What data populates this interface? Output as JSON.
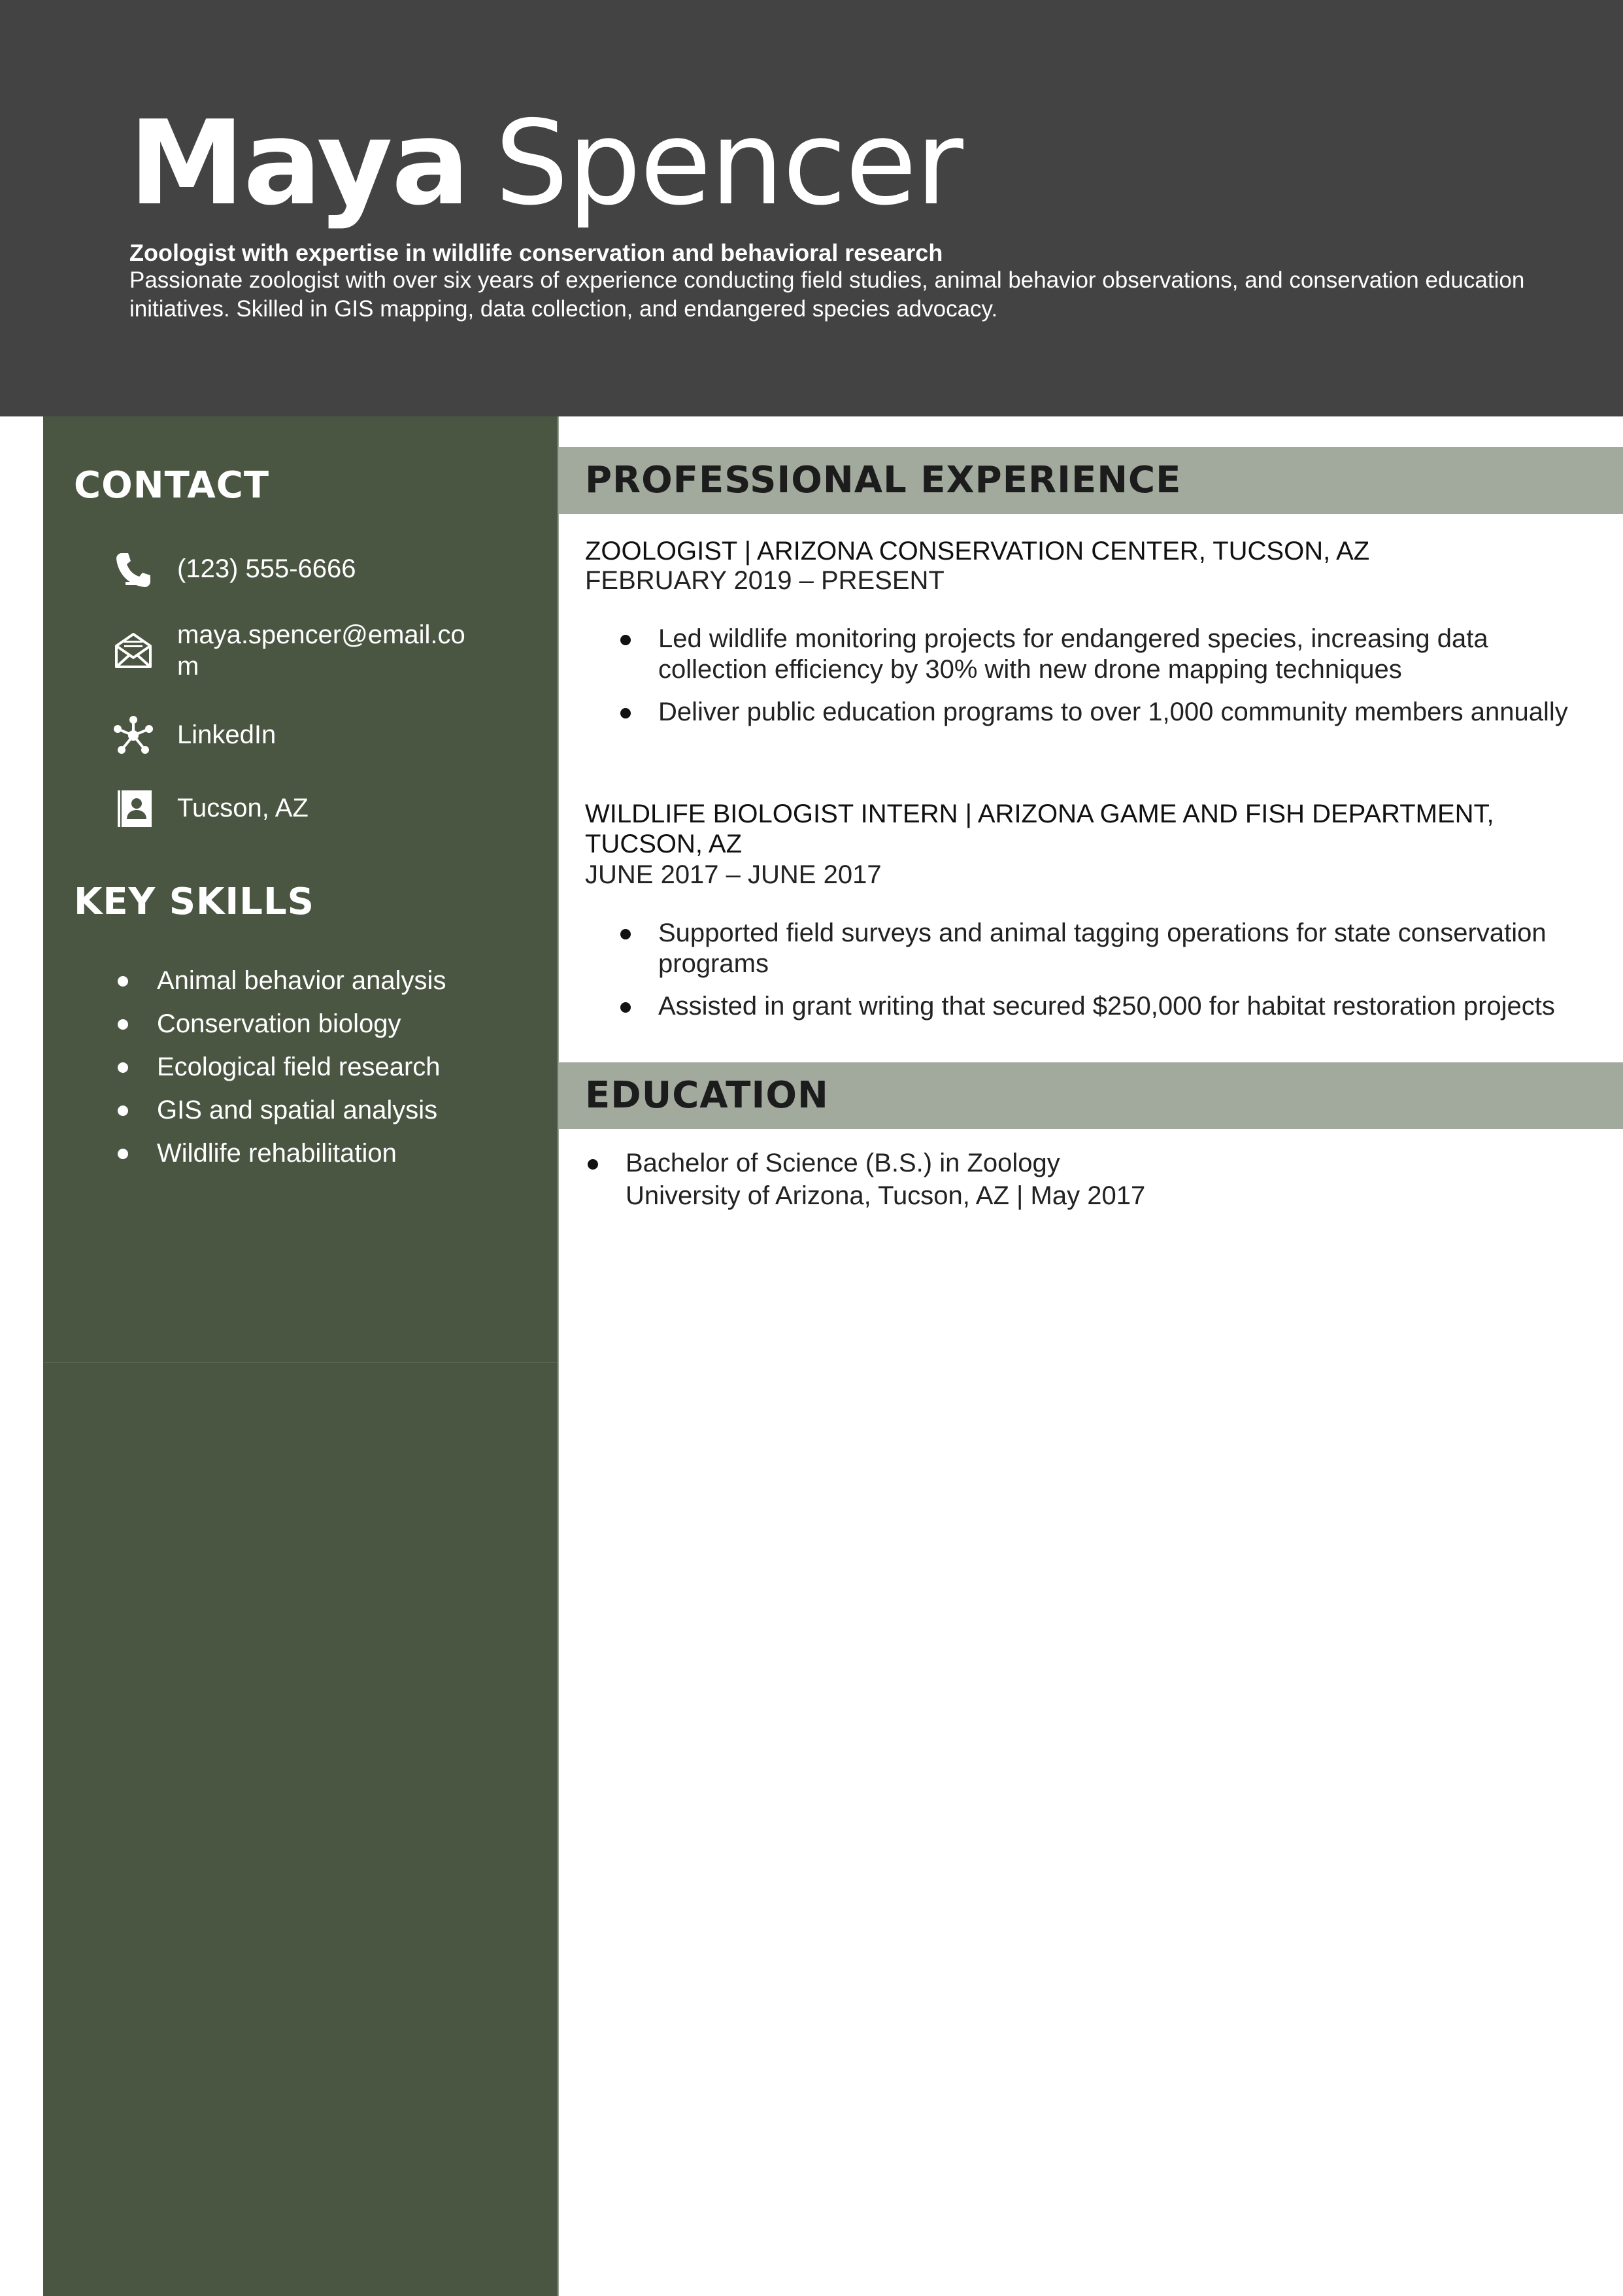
{
  "header": {
    "first_name": "Maya",
    "last_name": "Spencer",
    "headline": "Zoologist with expertise in wildlife conservation and behavioral research",
    "summary": "Passionate zoologist with over six years of experience conducting field studies, animal behavior observations, and conservation education initiatives. Skilled in GIS mapping, data collection, and endangered species advocacy."
  },
  "contact": {
    "heading": "CONTACT",
    "items": [
      {
        "icon": "phone-icon",
        "text": "(123) 555-6666"
      },
      {
        "icon": "envelope-icon",
        "text": "maya.spencer@email.com"
      },
      {
        "icon": "network-icon",
        "text": "LinkedIn"
      },
      {
        "icon": "contact-card-icon",
        "text": "Tucson, AZ"
      }
    ]
  },
  "skills": {
    "heading": "KEY SKILLS",
    "items": [
      "Animal behavior analysis",
      "Conservation biology",
      "Ecological field research",
      "GIS and spatial analysis",
      "Wildlife rehabilitation"
    ]
  },
  "experience": {
    "heading": "PROFESSIONAL EXPERIENCE",
    "jobs": [
      {
        "title": "ZOOLOGIST | ARIZONA CONSERVATION CENTER, TUCSON, AZ",
        "dates": "FEBRUARY 2019 – PRESENT",
        "bullets": [
          "Led wildlife monitoring projects for endangered species, increasing data collection efficiency by 30% with new drone mapping techniques",
          "Deliver public education programs to over 1,000 community members annually"
        ]
      },
      {
        "title": "WILDLIFE BIOLOGIST INTERN | ARIZONA GAME AND FISH DEPARTMENT, TUCSON, AZ",
        "dates": "JUNE 2017 – JUNE 2017",
        "bullets": [
          "Supported field surveys and animal tagging operations for state conservation programs",
          "Assisted in grant writing that secured $250,000 for habitat restoration projects"
        ]
      }
    ]
  },
  "education": {
    "heading": "EDUCATION",
    "items": [
      {
        "degree": "Bachelor of Science (B.S.) in Zoology",
        "school": "University of Arizona, Tucson, AZ | May 2017"
      }
    ]
  },
  "colors": {
    "header_bg": "#434343",
    "sidebar_bg": "#4a5642",
    "section_bar_bg": "#a2aa9e"
  }
}
